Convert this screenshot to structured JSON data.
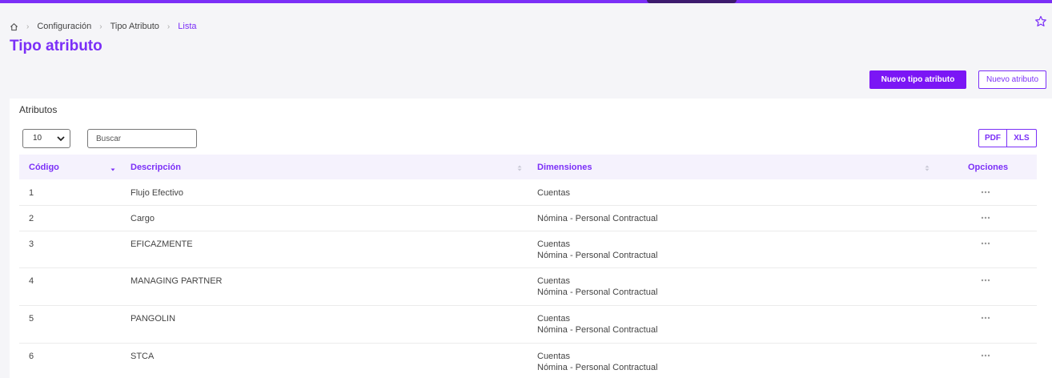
{
  "breadcrumb": {
    "items": [
      "Configuración",
      "Tipo Atributo"
    ],
    "current": "Lista"
  },
  "page": {
    "title": "Tipo atributo"
  },
  "actions": {
    "new_type": "Nuevo tipo atributo",
    "new_attribute": "Nuevo atributo"
  },
  "card": {
    "title": "Atributos",
    "page_size": "10",
    "search_placeholder": "Buscar",
    "export_pdf": "PDF",
    "export_xls": "XLS"
  },
  "table": {
    "columns": [
      "Código",
      "Descripción",
      "Dimensiones",
      "Opciones"
    ],
    "rows": [
      {
        "code": "1",
        "description": "Flujo Efectivo",
        "dimensions": [
          "Cuentas"
        ]
      },
      {
        "code": "2",
        "description": "Cargo",
        "dimensions": [
          "Nómina - Personal Contractual"
        ]
      },
      {
        "code": "3",
        "description": "EFICAZMENTE",
        "dimensions": [
          "Cuentas",
          "Nómina - Personal Contractual"
        ]
      },
      {
        "code": "4",
        "description": "MANAGING PARTNER",
        "dimensions": [
          "Cuentas",
          "Nómina - Personal Contractual"
        ]
      },
      {
        "code": "5",
        "description": "PANGOLIN",
        "dimensions": [
          "Cuentas",
          "Nómina - Personal Contractual"
        ]
      },
      {
        "code": "6",
        "description": "STCA",
        "dimensions": [
          "Cuentas",
          "Nómina - Personal Contractual"
        ]
      }
    ]
  },
  "colors": {
    "accent": "#7b2ff7",
    "primary_button": "#7b16f5",
    "header_bg": "#f5f2fd",
    "page_bg": "#f5f5f8"
  },
  "icons": {
    "home": "home-icon",
    "star": "star-icon",
    "chevron": "chevron-right-icon",
    "options": "more-horizontal-icon"
  }
}
